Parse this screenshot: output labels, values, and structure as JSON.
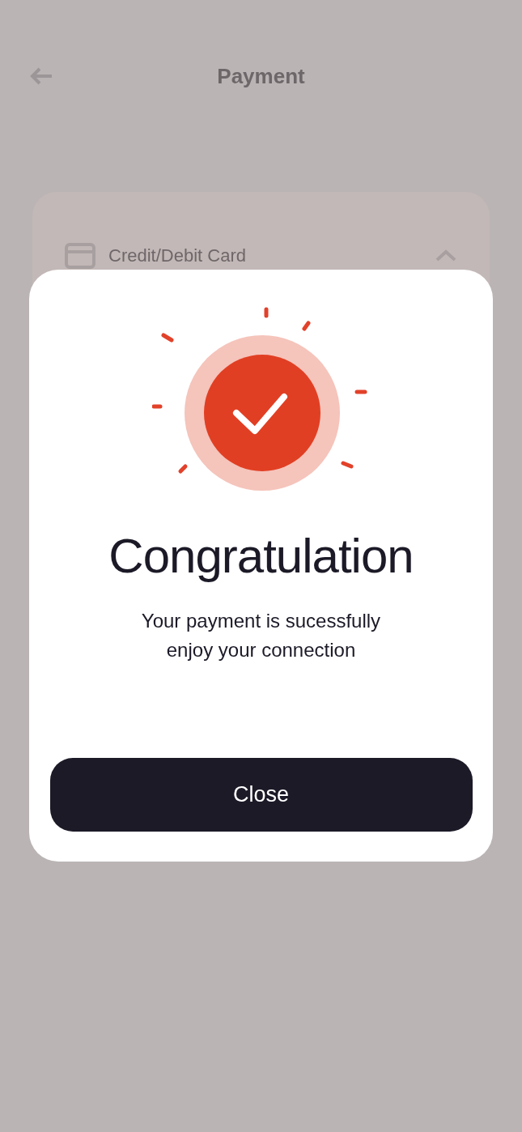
{
  "header": {
    "title": "Payment"
  },
  "payment_method": {
    "label": "Credit/Debit Card"
  },
  "dialog": {
    "title": "Congratulation",
    "message": [
      "Your payment is sucessfully",
      "enjoy your connection"
    ],
    "button": "Close"
  }
}
